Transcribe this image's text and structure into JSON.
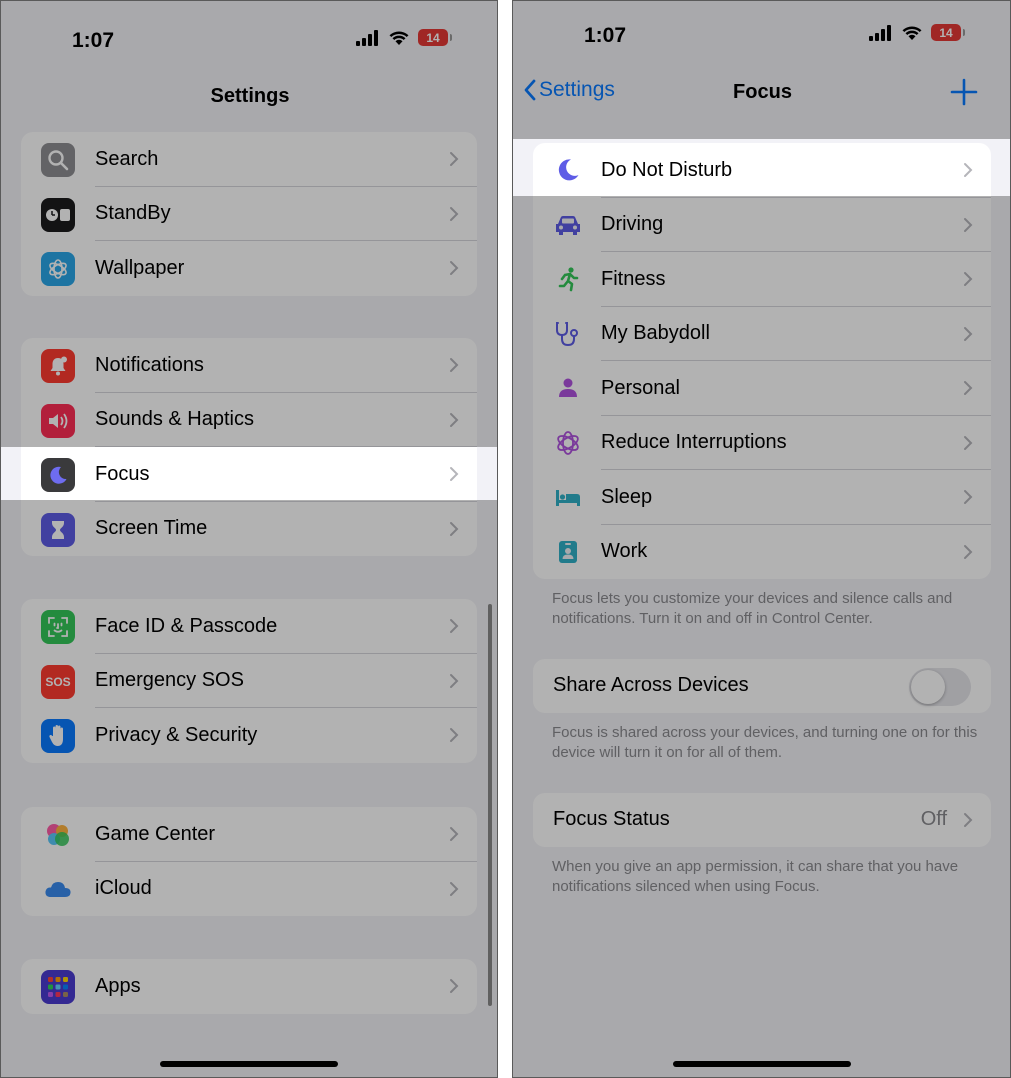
{
  "left": {
    "status": {
      "time": "1:07",
      "battery": "14"
    },
    "nav_title": "Settings",
    "groups": [
      [
        {
          "label": "Search"
        },
        {
          "label": "StandBy"
        },
        {
          "label": "Wallpaper"
        }
      ],
      [
        {
          "label": "Notifications"
        },
        {
          "label": "Sounds & Haptics"
        },
        {
          "label": "Focus"
        },
        {
          "label": "Screen Time"
        }
      ],
      [
        {
          "label": "Face ID & Passcode"
        },
        {
          "label": "Emergency SOS"
        },
        {
          "label": "Privacy & Security"
        }
      ],
      [
        {
          "label": "Game Center"
        },
        {
          "label": "iCloud"
        }
      ],
      [
        {
          "label": "Apps"
        }
      ]
    ],
    "sos_text": "SOS"
  },
  "right": {
    "status": {
      "time": "1:07",
      "battery": "14"
    },
    "nav_back": "Settings",
    "nav_title": "Focus",
    "focus_modes": [
      {
        "label": "Do Not Disturb"
      },
      {
        "label": "Driving"
      },
      {
        "label": "Fitness"
      },
      {
        "label": "My Babydoll"
      },
      {
        "label": "Personal"
      },
      {
        "label": "Reduce Interruptions"
      },
      {
        "label": "Sleep"
      },
      {
        "label": "Work"
      }
    ],
    "modes_footer": "Focus lets you customize your devices and silence calls and notifications. Turn it on and off in Control Center.",
    "share": {
      "label": "Share Across Devices",
      "on": false
    },
    "share_footer": "Focus is shared across your devices, and turning one on for this device will turn it on for all of them.",
    "status_row": {
      "label": "Focus Status",
      "value": "Off"
    },
    "status_footer": "When you give an app permission, it can share that you have notifications silenced when using Focus."
  },
  "colors": {
    "accent": "#0a7aff",
    "focus_purple": "#5e5ce6",
    "background": "#f2f2f7"
  }
}
